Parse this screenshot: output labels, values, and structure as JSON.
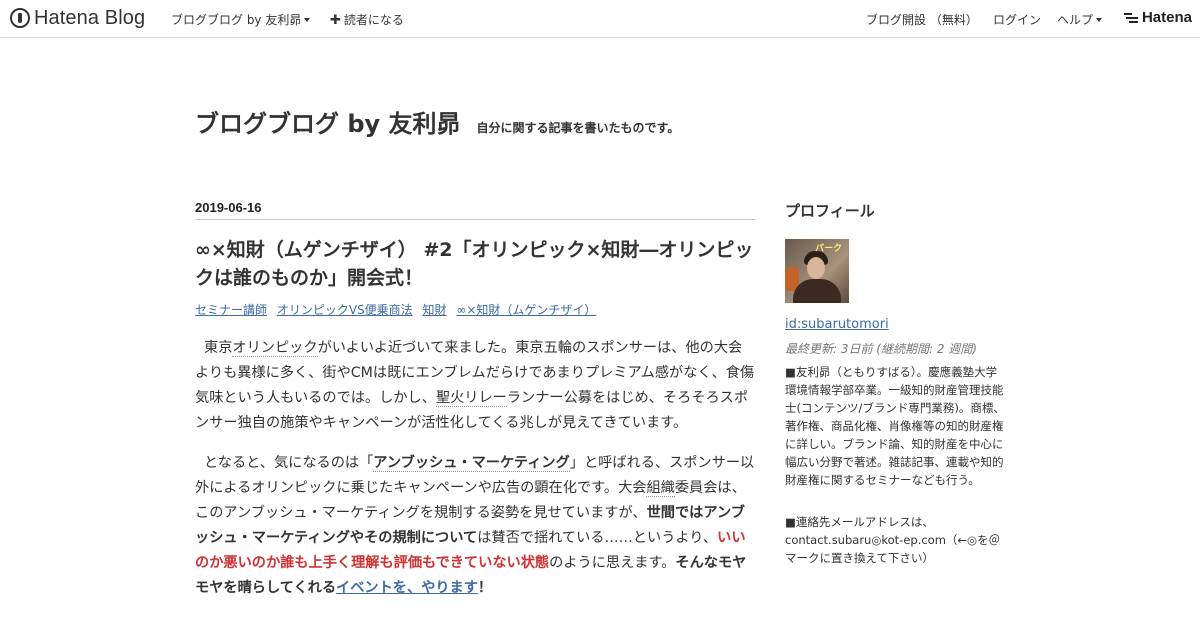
{
  "globalbar": {
    "logo_text": "Hatena Blog",
    "blog_menu": "ブログブログ by 友利昴",
    "subscribe": "読者になる",
    "open_blog": "ブログ開設 （無料）",
    "login": "ログイン",
    "help": "ヘルプ",
    "brand": "Hatena"
  },
  "blog": {
    "title": "ブログブログ by 友利昴",
    "description": "自分に関する記事を書いたものです。"
  },
  "entry": {
    "date": "2019-06-16",
    "title": "∞×知財（ムゲンチザイ） #2「オリンピック×知財―オリンピックは誰のものか」開会式！",
    "categories": [
      "セミナー講師",
      "オリンピックVS便乗商法",
      "知財",
      "∞×知財（ムゲンチザイ）"
    ],
    "p1": {
      "a": "東京",
      "kw1": "オリンピック",
      "b": "がいよいよ近づいて来ました。東京五輪のスポンサーは、他の大会よりも異様に多く、街やCMは既にエンブレムだらけであまりプレミアム感がなく、食傷気味という人もいるのでは。しかし、",
      "kw2": "聖火リレー",
      "c": "ランナー公募をはじめ、そろそろスポンサー独自の施策やキャンペーンが活性化してくる兆しが見えてきています。"
    },
    "p2": {
      "a": "となると、気になるのは「",
      "kw1": "アンブッシュ・マーケティング",
      "b": "」と呼ばれる、スポンサー以外によるオリンピックに乗じたキャンペーンや広告の顕在化です。大会",
      "kw2": "組織",
      "c": "委員会は、このアンブッシュ・マーケティングを規制する姿勢を見せていますが、",
      "strong1": "世間ではアンブッシュ・マーケティングやその規制について",
      "d": "は賛否で揺れている……というより、",
      "red": "いいのか悪いのか誰も上手く理解も評価もできていない状態",
      "e": "のように思えます。",
      "strong2": "そんなモヤモヤを晴らしてくれる",
      "link": "イベントを、やります",
      "strong3": "！"
    }
  },
  "sidebar": {
    "title": "プロフィール",
    "avatar_sign": "パーク",
    "user_id": "id:subarutomori",
    "meta": "最終更新: 3日前 (継続期間: 2 週間)",
    "bio": "■友利昴（ともりすばる）。慶應義塾大学環境情報学部卒業。一級知的財産管理技能士(コンテンツ/ブランド専門業務)。商標、著作権、商品化権、肖像権等の知的財産権に詳しい。ブランド論、知的財産を中心に幅広い分野で著述。雑誌記事、連載や知的財産権に関するセミナーなども行う。",
    "contact": "■連絡先メールアドレスは、contact.subaru◎kot-ep.com（←◎を＠マークに置き換えて下さい）"
  }
}
